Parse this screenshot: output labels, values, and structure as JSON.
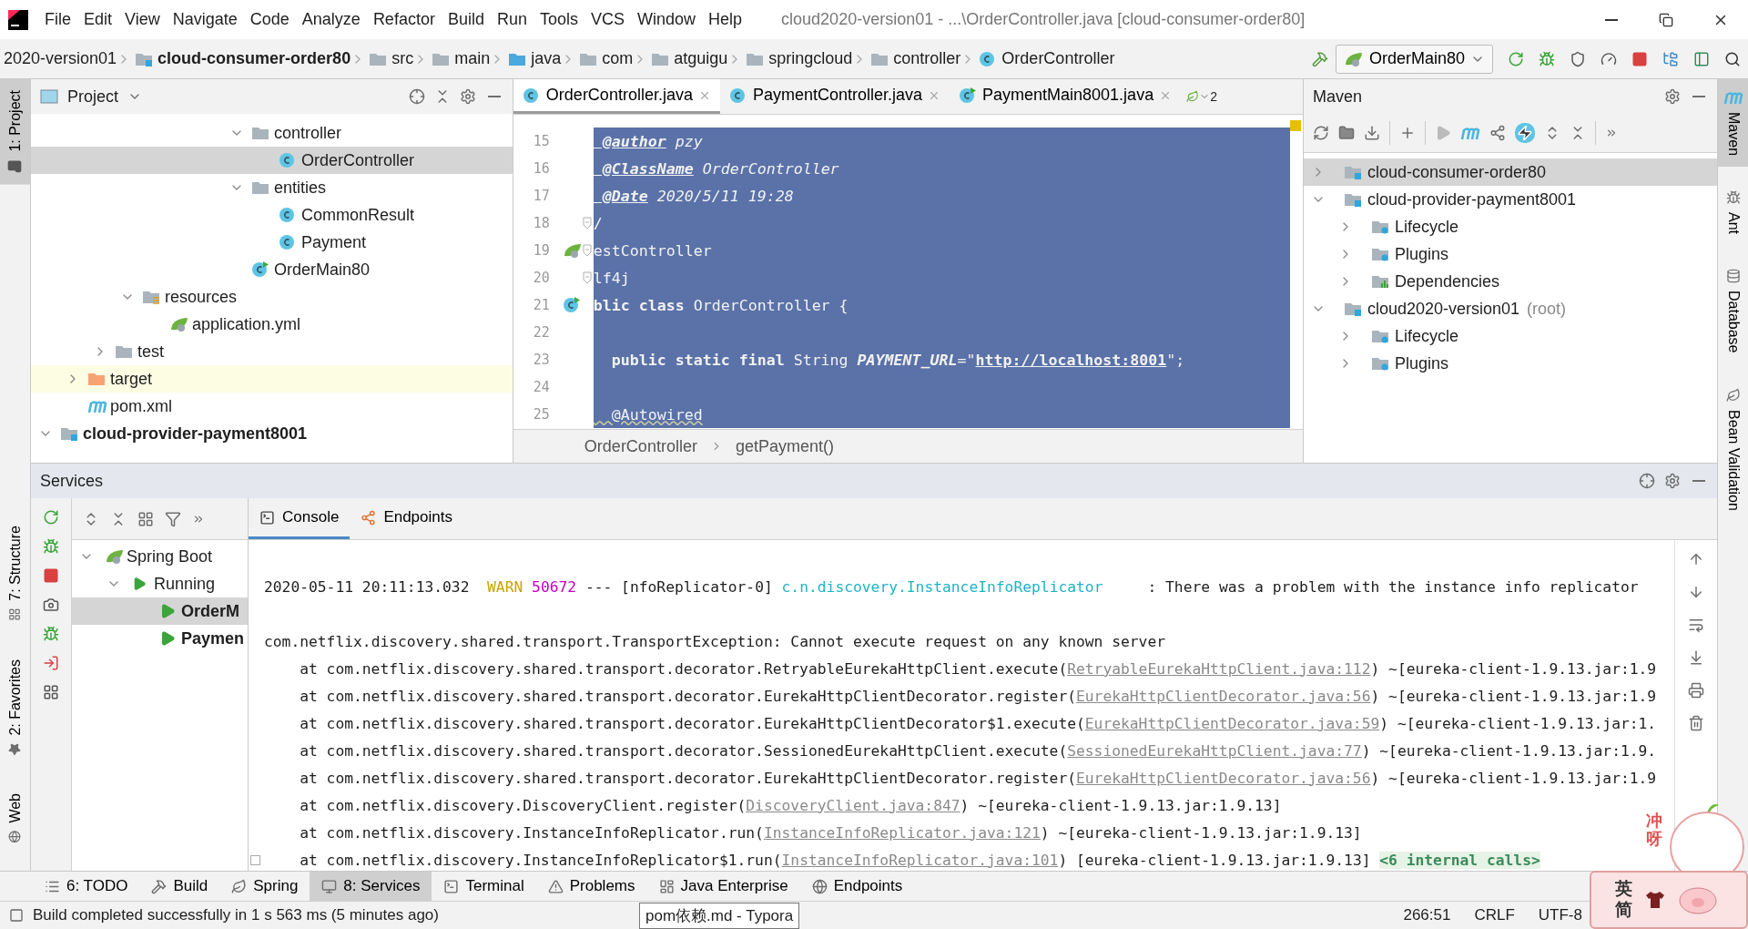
{
  "window": {
    "menu": [
      "File",
      "Edit",
      "View",
      "Navigate",
      "Code",
      "Analyze",
      "Refactor",
      "Build",
      "Run",
      "Tools",
      "VCS",
      "Window",
      "Help"
    ],
    "title": "cloud2020-version01 - ...\\OrderController.java [cloud-consumer-order80]"
  },
  "nav_bar": {
    "breadcrumbs": [
      {
        "label": "2020-version01",
        "kind": "project"
      },
      {
        "label": "cloud-consumer-order80",
        "kind": "module"
      },
      {
        "label": "src",
        "kind": "folder"
      },
      {
        "label": "main",
        "kind": "folder"
      },
      {
        "label": "java",
        "kind": "source"
      },
      {
        "label": "com",
        "kind": "folder"
      },
      {
        "label": "atguigu",
        "kind": "folder"
      },
      {
        "label": "springcloud",
        "kind": "folder"
      },
      {
        "label": "controller",
        "kind": "folder"
      },
      {
        "label": "OrderController",
        "kind": "class"
      }
    ],
    "run_config": "OrderMain80"
  },
  "left_stripe": {
    "top": [
      {
        "label": "1: Project",
        "selected": true
      }
    ],
    "bottom": [
      {
        "label": "7: Structure",
        "selected": false
      },
      {
        "label": "2: Favorites",
        "selected": false
      },
      {
        "label": "Web",
        "selected": false
      }
    ]
  },
  "right_stripe": [
    {
      "label": "Maven",
      "kind": "maven",
      "selected": true
    },
    {
      "label": "Ant",
      "kind": "ant",
      "selected": false
    },
    {
      "label": "Database",
      "kind": "database",
      "selected": false
    },
    {
      "label": "Bean Validation",
      "kind": "bean",
      "selected": false
    }
  ],
  "project": {
    "title": "Project",
    "tree": [
      {
        "children": [
          {
            "children": [
              {
                "children": [
                  {
                    "children": [
                      {
                        "children": [
                          {
                            "children": [
                              {
                                "children": [
                                  {
                                    "label": "controller",
                                    "kind": "folder",
                                    "expanded": true,
                                    "selected": false,
                                    "children": [
                                      {
                                        "label": "OrderController",
                                        "kind": "class",
                                        "selected": true
                                      }
                                    ]
                                  },
                                  {
                                    "label": "entities",
                                    "kind": "folder",
                                    "expanded": true,
                                    "selected": false,
                                    "children": [
                                      {
                                        "label": "CommonResult",
                                        "kind": "class",
                                        "selected": false
                                      },
                                      {
                                        "label": "Payment",
                                        "kind": "class",
                                        "selected": false
                                      }
                                    ]
                                  },
                                  {
                                    "label": "OrderMain80",
                                    "kind": "main",
                                    "selected": false
                                  }
                                ]
                              }
                            ]
                          }
                        ]
                      }
                    ]
                  },
                  {
                    "label": "resources",
                    "kind": "resources",
                    "expanded": true,
                    "selected": false,
                    "children": [
                      {
                        "label": "application.yml",
                        "kind": "yml",
                        "selected": false
                      }
                    ]
                  }
                ]
              },
              {
                "label": "test",
                "kind": "folder",
                "expanded": false,
                "selected": false
              }
            ]
          },
          {
            "label": "target",
            "kind": "excluded",
            "expanded": false,
            "selected": false
          },
          {
            "label": "pom.xml",
            "kind": "pom",
            "selected": false
          }
        ]
      },
      {
        "label": "cloud-provider-payment8001",
        "kind": "module",
        "expanded": true,
        "selected": false
      }
    ]
  },
  "editor": {
    "tabs": [
      {
        "label": "OrderController.java",
        "kind": "class",
        "selected": true
      },
      {
        "label": "PaymentController.java",
        "kind": "class",
        "selected": false
      },
      {
        "label": "PaymentMain8001.java",
        "kind": "main",
        "selected": false
      }
    ],
    "more_tabs": "2",
    "lines": [
      {
        "number": "15",
        "kind": "plain",
        "fold": false,
        "tokens": [
          {
            "kind": "tag",
            "text": " @author"
          },
          {
            "kind": "doc",
            "text": " pzy"
          }
        ]
      },
      {
        "number": "16",
        "kind": "plain",
        "fold": false,
        "tokens": [
          {
            "kind": "tag",
            "text": " @ClassName"
          },
          {
            "kind": "doc",
            "text": " OrderController"
          }
        ]
      },
      {
        "number": "17",
        "kind": "plain",
        "fold": false,
        "tokens": [
          {
            "kind": "tag",
            "text": " @Date"
          },
          {
            "kind": "doc",
            "text": " 2020/5/11 19:28"
          }
        ]
      },
      {
        "number": "18",
        "kind": "plain",
        "fold": true,
        "tokens": [
          {
            "kind": "plain",
            "text": "/"
          }
        ]
      },
      {
        "number": "19",
        "kind": "bean",
        "fold": true,
        "tokens": [
          {
            "kind": "plain",
            "text": "estController"
          }
        ]
      },
      {
        "number": "20",
        "kind": "plain",
        "fold": true,
        "tokens": [
          {
            "kind": "plain",
            "text": "lf4j"
          }
        ]
      },
      {
        "number": "21",
        "kind": "class-bean",
        "fold": false,
        "tokens": [
          {
            "kind": "keyword",
            "text": "blic class"
          },
          {
            "kind": "plain",
            "text": " OrderController {"
          }
        ]
      },
      {
        "number": "22",
        "kind": "plain",
        "fold": false
      },
      {
        "number": "23",
        "kind": "plain",
        "fold": false,
        "tokens": [
          {
            "kind": "keyword",
            "text": "  public static final"
          },
          {
            "kind": "plain",
            "text": " String "
          },
          {
            "kind": "constant",
            "text": "PAYMENT_URL"
          },
          {
            "kind": "plain",
            "text": "=\""
          },
          {
            "kind": "url",
            "text": "http://localhost:8001"
          },
          {
            "kind": "plain",
            "text": "\";"
          }
        ]
      },
      {
        "number": "24",
        "kind": "plain",
        "fold": false
      },
      {
        "number": "25",
        "kind": "plain",
        "fold": false,
        "tokens": [
          {
            "kind": "annotation",
            "text": "  @Autowired"
          }
        ]
      }
    ],
    "breadcrumbs": [
      "OrderController",
      "getPayment()"
    ]
  },
  "maven": {
    "title": "Maven",
    "tree": [
      {
        "label": "cloud-consumer-order80",
        "kind": "module",
        "expanded": false,
        "selected": true
      },
      {
        "label": "cloud-provider-payment8001",
        "kind": "module",
        "expanded": true,
        "selected": false,
        "children": [
          {
            "label": "Lifecycle",
            "kind": "lifecycle",
            "expanded": false,
            "selected": false
          },
          {
            "label": "Plugins",
            "kind": "lifecycle",
            "expanded": false,
            "selected": false
          },
          {
            "label": "Dependencies",
            "kind": "dependencies",
            "expanded": false,
            "selected": false
          }
        ]
      },
      {
        "label": "cloud2020-version01",
        "note": "(root)",
        "kind": "module",
        "expanded": true,
        "selected": false,
        "children": [
          {
            "label": "Lifecycle",
            "kind": "lifecycle",
            "expanded": false,
            "selected": false
          },
          {
            "label": "Plugins",
            "kind": "lifecycle",
            "expanded": false,
            "selected": false
          }
        ]
      }
    ]
  },
  "services": {
    "title": "Services",
    "tree": [
      {
        "label": "Spring Boot",
        "kind": "spring",
        "expanded": true,
        "selected": false,
        "children": [
          {
            "label": "Running",
            "kind": "running",
            "expanded": true,
            "selected": false,
            "children": [
              {
                "label": "OrderM",
                "kind": "app",
                "selected": true
              },
              {
                "label": "Paymen",
                "kind": "app",
                "selected": false
              }
            ]
          }
        ]
      }
    ],
    "tabs": [
      {
        "label": "Console",
        "kind": "console",
        "selected": true
      },
      {
        "label": "Endpoints",
        "kind": "endpoints",
        "selected": false
      }
    ],
    "console": [
      {
        "kind": "log",
        "segments": [
          {
            "kind": "plain",
            "text": "2020-05-11 20:11:13.032  "
          },
          {
            "kind": "warn",
            "text": "WARN"
          },
          {
            "kind": "pid",
            "text": " 50672"
          },
          {
            "kind": "plain",
            "text": " --- [nfoReplicator-0] "
          },
          {
            "kind": "logger",
            "text": "c.n.discovery.InstanceInfoReplicator"
          },
          {
            "kind": "plain",
            "text": "     : There was a problem with the instance info replicator"
          }
        ]
      },
      {
        "kind": "exception",
        "segments": [
          {
            "kind": "plain",
            "text": "com.netflix.discovery.shared.transport.TransportException: Cannot execute request on any known server"
          }
        ]
      },
      {
        "kind": "frame",
        "segments": [
          {
            "kind": "plain",
            "text": "at com.netflix.discovery.shared.transport.decorator.RetryableEurekaHttpClient.execute("
          },
          {
            "kind": "link",
            "text": "RetryableEurekaHttpClient.java:112"
          },
          {
            "kind": "plain",
            "text": ") ~[eureka-client-1.9.13.jar:1.9"
          }
        ]
      },
      {
        "kind": "frame",
        "segments": [
          {
            "kind": "plain",
            "text": "at com.netflix.discovery.shared.transport.decorator.EurekaHttpClientDecorator.register("
          },
          {
            "kind": "link",
            "text": "EurekaHttpClientDecorator.java:56"
          },
          {
            "kind": "plain",
            "text": ") ~[eureka-client-1.9.13.jar:1.9"
          }
        ]
      },
      {
        "kind": "frame",
        "segments": [
          {
            "kind": "plain",
            "text": "at com.netflix.discovery.shared.transport.decorator.EurekaHttpClientDecorator$1.execute("
          },
          {
            "kind": "link",
            "text": "EurekaHttpClientDecorator.java:59"
          },
          {
            "kind": "plain",
            "text": ") ~[eureka-client-1.9.13.jar:1."
          }
        ]
      },
      {
        "kind": "frame",
        "segments": [
          {
            "kind": "plain",
            "text": "at com.netflix.discovery.shared.transport.decorator.SessionedEurekaHttpClient.execute("
          },
          {
            "kind": "link",
            "text": "SessionedEurekaHttpClient.java:77"
          },
          {
            "kind": "plain",
            "text": ") ~[eureka-client-1.9.13.jar:1.9."
          }
        ]
      },
      {
        "kind": "frame",
        "segments": [
          {
            "kind": "plain",
            "text": "at com.netflix.discovery.shared.transport.decorator.EurekaHttpClientDecorator.register("
          },
          {
            "kind": "link",
            "text": "EurekaHttpClientDecorator.java:56"
          },
          {
            "kind": "plain",
            "text": ") ~[eureka-client-1.9.13.jar:1.9"
          }
        ]
      },
      {
        "kind": "frame",
        "segments": [
          {
            "kind": "plain",
            "text": "at com.netflix.discovery.DiscoveryClient.register("
          },
          {
            "kind": "link",
            "text": "DiscoveryClient.java:847"
          },
          {
            "kind": "plain",
            "text": ") ~[eureka-client-1.9.13.jar:1.9.13]"
          }
        ]
      },
      {
        "kind": "frame",
        "segments": [
          {
            "kind": "plain",
            "text": "at com.netflix.discovery.InstanceInfoReplicator.run("
          },
          {
            "kind": "link",
            "text": "InstanceInfoReplicator.java:121"
          },
          {
            "kind": "plain",
            "text": ") ~[eureka-client-1.9.13.jar:1.9.13]"
          }
        ]
      },
      {
        "kind": "folded",
        "segments": [
          {
            "kind": "plain",
            "text": "at com.netflix.discovery.InstanceInfoReplicator$1.run("
          },
          {
            "kind": "link",
            "text": "InstanceInfoReplicator.java:101"
          },
          {
            "kind": "plain",
            "text": ") [eureka-client-1.9.13.jar:1.9.13] "
          },
          {
            "kind": "fold",
            "text": "<6 internal calls>"
          }
        ]
      }
    ]
  },
  "tool_tabs": [
    {
      "label": "6: TODO",
      "kind": "todo",
      "selected": false
    },
    {
      "label": "Build",
      "kind": "build",
      "selected": false
    },
    {
      "label": "Spring",
      "kind": "spring",
      "selected": false
    },
    {
      "label": "8: Services",
      "kind": "services",
      "selected": true
    },
    {
      "label": "Terminal",
      "kind": "terminal",
      "selected": false
    },
    {
      "label": "Problems",
      "kind": "problems",
      "selected": false
    },
    {
      "label": "Java Enterprise",
      "kind": "enterprise",
      "selected": false
    },
    {
      "label": "Endpoints",
      "kind": "endpoints",
      "selected": false
    }
  ],
  "status_bar": {
    "message": "Build completed successfully in 1 s 563 ms (5 minutes ago)",
    "tooltip": "pom依赖.md - Typora",
    "position": "266:51",
    "line_separator": "CRLF",
    "encoding": "UTF-8"
  },
  "ime": {
    "caption": "冲呀",
    "mode": "英",
    "script": "简"
  }
}
